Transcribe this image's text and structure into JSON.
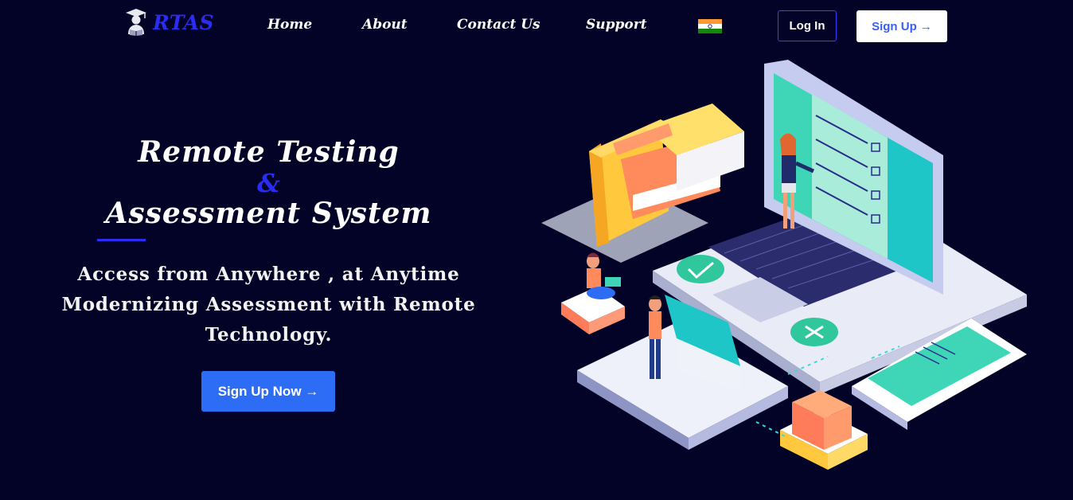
{
  "brand": {
    "name": "RTAS",
    "logo_icon": "graduate-reading-icon",
    "color": "#2a2cf0"
  },
  "nav": {
    "links": [
      {
        "label": "Home"
      },
      {
        "label": "About"
      },
      {
        "label": "Contact Us"
      },
      {
        "label": "Support"
      }
    ],
    "flag_icon": "india-flag-icon",
    "login_label": "Log In",
    "signup_label": "Sign Up →"
  },
  "hero": {
    "title_line1": "Remote Testing",
    "title_amp": "&",
    "title_line2": "Assessment System",
    "subtitle_lines": [
      "Access from Anywhere , at Anytime",
      "Modernizing Assessment with Remote",
      "Technology."
    ],
    "cta_label": "Sign Up Now →"
  },
  "colors": {
    "background": "#030327",
    "accent": "#2a2cf0",
    "cta": "#2d6df6"
  }
}
